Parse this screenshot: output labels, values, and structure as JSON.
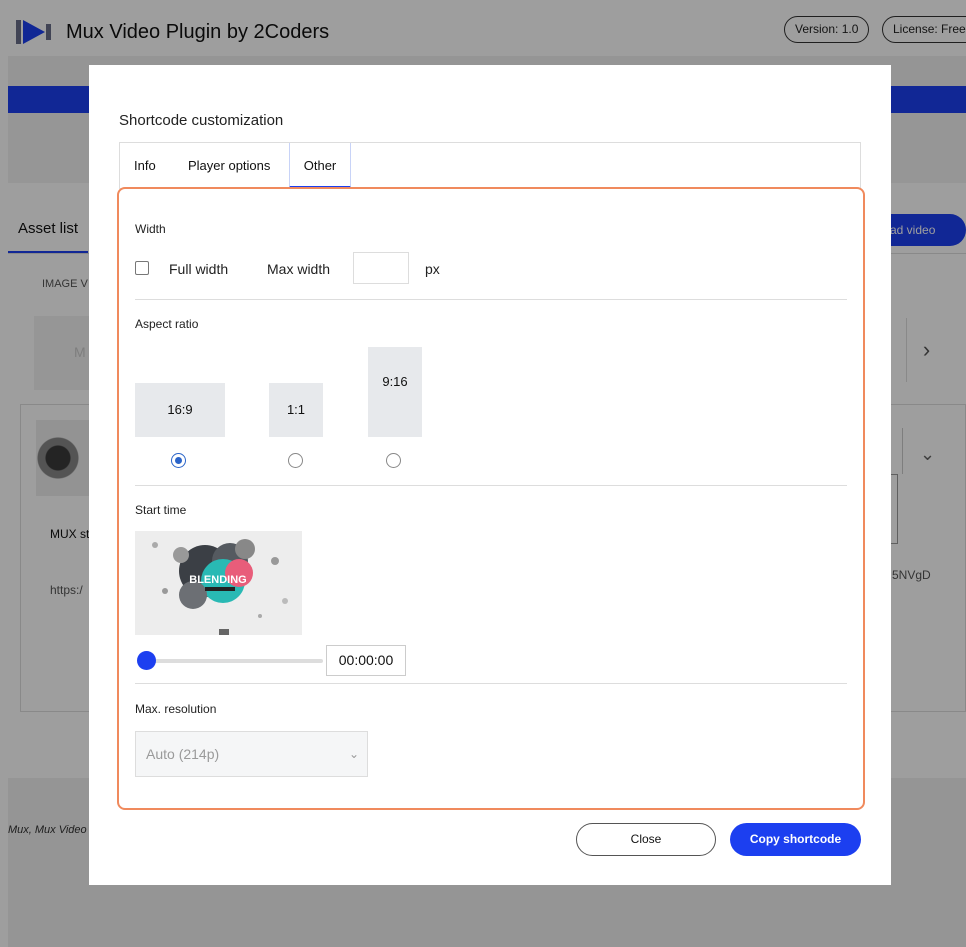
{
  "app": {
    "title": "Mux Video Plugin by 2Coders",
    "version": "Version: 1.0",
    "license": "License: Free"
  },
  "background": {
    "asset_tab": "Asset list",
    "upload_button": "ad video",
    "column_header": "IMAGE V",
    "thumb_placeholder": "M",
    "row_title": "MUX st",
    "row_url": "https:/",
    "row_id": "5NVgD",
    "footer_text": "Mux, Mux Video"
  },
  "modal": {
    "title": "Shortcode customization",
    "tabs": [
      {
        "label": "Info"
      },
      {
        "label": "Player options"
      },
      {
        "label": "Other"
      }
    ],
    "active_tab": "Other",
    "width": {
      "label": "Width",
      "full_width_label": "Full width",
      "full_width_checked": false,
      "max_width_label": "Max width",
      "max_width_value": "",
      "unit": "px"
    },
    "aspect_ratio": {
      "label": "Aspect ratio",
      "options": [
        {
          "label": "16:9",
          "selected": true
        },
        {
          "label": "1:1",
          "selected": false
        },
        {
          "label": "9:16",
          "selected": false
        }
      ]
    },
    "start_time": {
      "label": "Start time",
      "value": "00:00:00",
      "thumb_text": "BLENDING",
      "slider_fraction": 0
    },
    "max_resolution": {
      "label": "Max. resolution",
      "selected": "Auto (214p)"
    },
    "buttons": {
      "close": "Close",
      "copy": "Copy shortcode"
    }
  },
  "colors": {
    "accent": "#1c3ff0",
    "highlight_border": "#f08a5d",
    "radio": "#2a64c9"
  }
}
